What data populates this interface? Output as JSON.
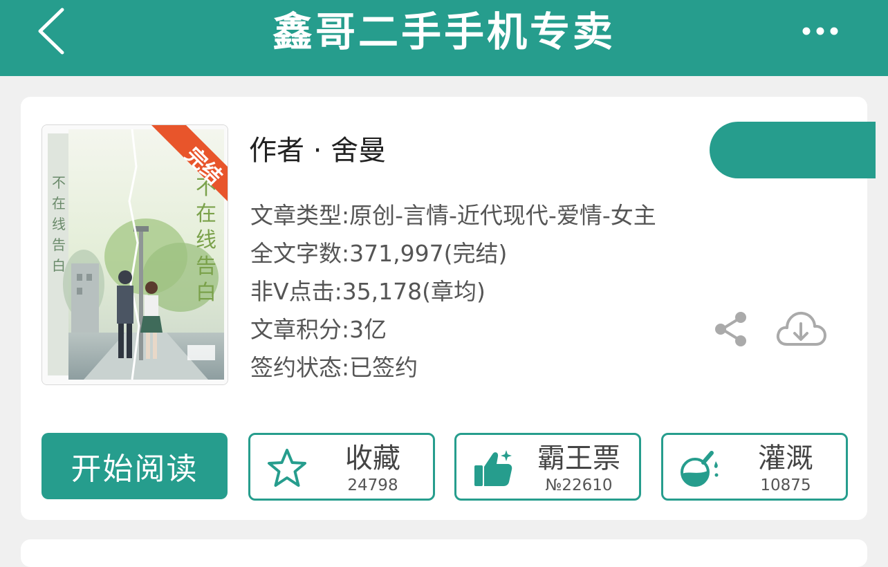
{
  "header": {
    "title": "鑫哥二手手机专卖"
  },
  "book": {
    "author": "作者 · 舍曼",
    "badge": "完结",
    "cover_title": "不在线告白",
    "tag_label": "",
    "info": [
      "文章类型:原创-言情-近代现代-爱情-女主",
      "全文字数:371,997(完结)",
      "非V点击:35,178(章均)",
      "文章积分:3亿",
      "签约状态:已签约"
    ]
  },
  "actions": {
    "read": "开始阅读",
    "collect": {
      "label": "收藏",
      "count": "24798"
    },
    "vote": {
      "label": "霸王票",
      "count": "№22610"
    },
    "nutrient": {
      "label": "灌溉",
      "count": "10875"
    }
  },
  "colors": {
    "accent": "#269d8d",
    "badge": "#e8552b"
  },
  "icons": [
    "back-arrow-icon",
    "more-icon",
    "share-icon",
    "download-cloud-icon",
    "star-icon",
    "thumbs-up-icon",
    "flask-icon"
  ]
}
